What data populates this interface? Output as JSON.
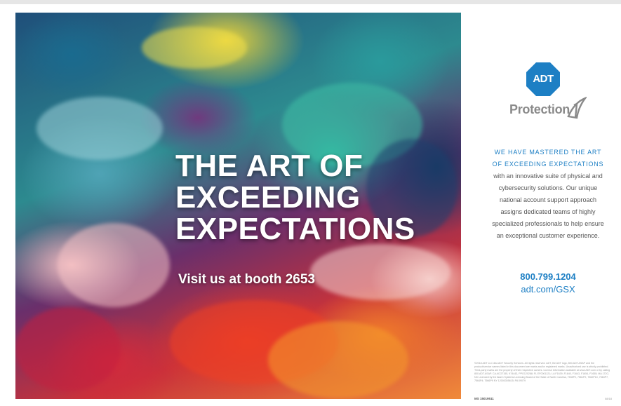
{
  "ad": {
    "headline": [
      "THE ART OF",
      "EXCEEDING",
      "EXPECTATIONS"
    ],
    "booth": "Visit us at booth 2653"
  },
  "brand": {
    "logo_text": "ADT",
    "sub_brand": "Protection",
    "accent_color": "#1d7fc4"
  },
  "copy": {
    "highlight": [
      "WE HAVE MASTERED THE ART",
      "OF EXCEEDING EXPECTATIONS"
    ],
    "body": [
      "with an innovative suite of physical and",
      "cybersecurity solutions. Our unique",
      "national account support approach",
      "assigns dedicated teams of highly",
      "specialized professionals to help ensure",
      "an exceptional customer experience."
    ]
  },
  "contact": {
    "phone": "800.799.1204",
    "url": "adt.com/GSX"
  },
  "legal": {
    "text": "©2018 ADT LLC dba ADT Security Services. All rights reserved. ADT, the ADT logo, 800.ADT.ASAP and the product/service names listed in this document are marks and/or registered marks. Unauthorized use is strictly prohibited. Third-party marks are the property of their respective owners. License information available at www.ADT.com or by calling 800.ADT.ASAP. CA ACO7155, 974443, PPO120288; FL EF0001121; LA F1639, F1640, F1643, F1654, F1655; MA 172C; NC Licensed by the Alarm Systems Licensing Board of the State of North Carolina, 7535P2, 7561P2, 7562P10, 7563P7, 7564P4; 7566P9 NY 12000305615; PA 09079",
    "code": "MS 15019511",
    "date": "08/18"
  }
}
